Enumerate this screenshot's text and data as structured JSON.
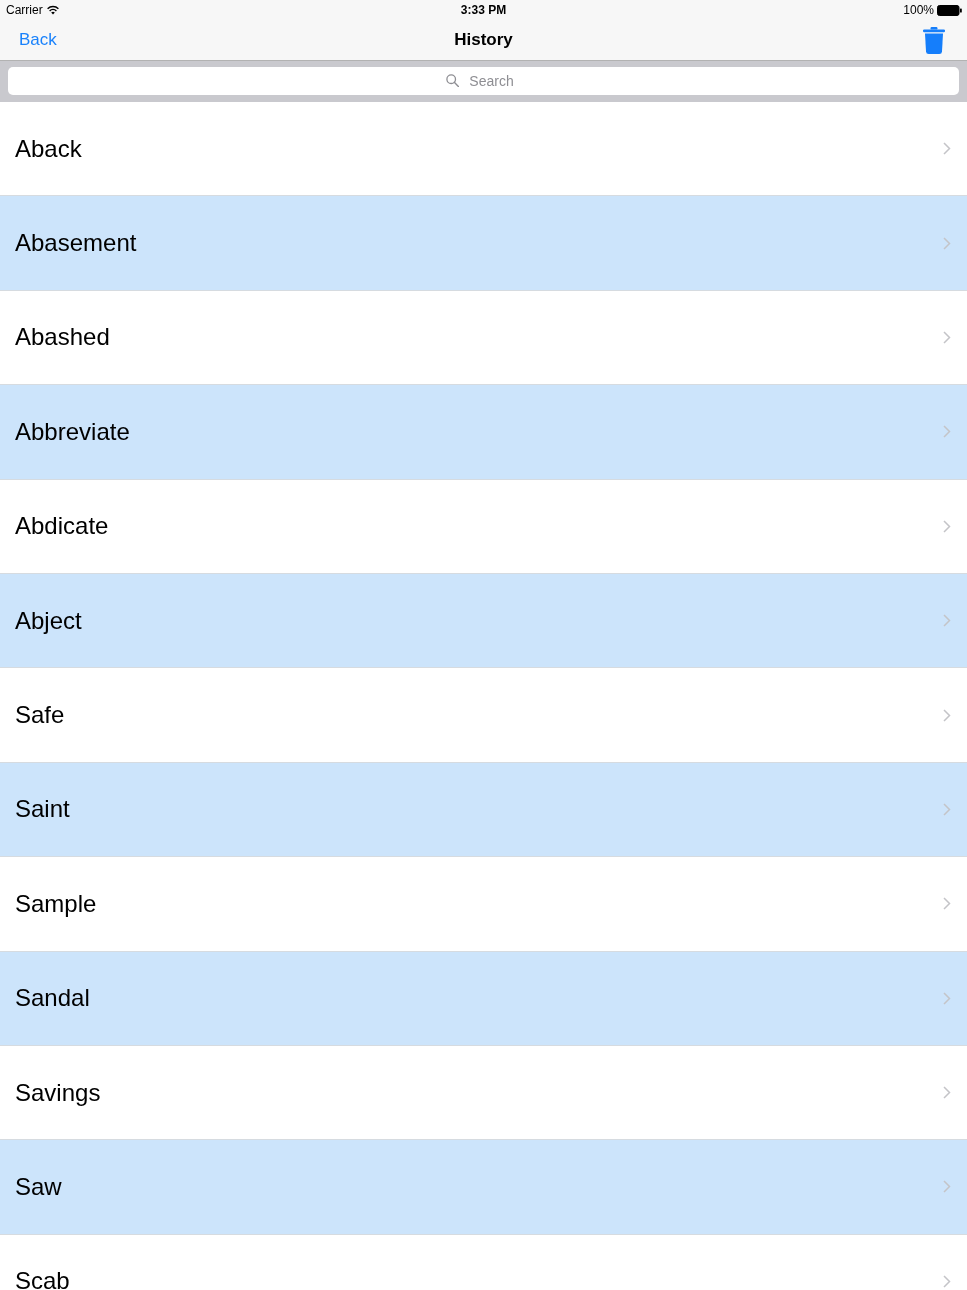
{
  "status_bar": {
    "carrier": "Carrier",
    "time": "3:33 PM",
    "battery": "100%"
  },
  "nav_bar": {
    "back": "Back",
    "title": "History"
  },
  "search": {
    "placeholder": "Search"
  },
  "rows": [
    {
      "label": "Aback"
    },
    {
      "label": "Abasement"
    },
    {
      "label": "Abashed"
    },
    {
      "label": "Abbreviate"
    },
    {
      "label": "Abdicate"
    },
    {
      "label": "Abject"
    },
    {
      "label": "Safe"
    },
    {
      "label": "Saint"
    },
    {
      "label": "Sample"
    },
    {
      "label": "Sandal"
    },
    {
      "label": "Savings"
    },
    {
      "label": "Saw"
    },
    {
      "label": "Scab"
    }
  ]
}
